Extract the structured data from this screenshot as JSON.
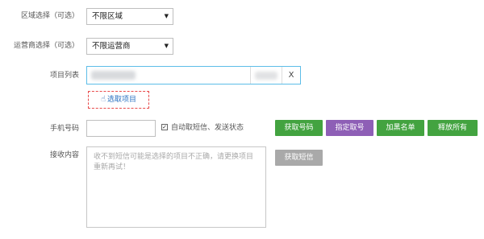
{
  "form": {
    "region": {
      "label": "区域选择（可选）",
      "value": "不限区域"
    },
    "operator": {
      "label": "运营商选择（可选）",
      "value": "不限运营商"
    },
    "project": {
      "label": "项目列表",
      "value": "",
      "clear_label": "X",
      "pick_button": "选取项目"
    },
    "phone": {
      "label": "手机号码",
      "value": "",
      "auto_checkbox_checked": true,
      "auto_label": "自动取短信、发送状态"
    },
    "buttons": {
      "get_number": "获取号码",
      "specify_number": "指定取号",
      "blacklist": "加黑名单",
      "release_all": "释放所有"
    },
    "receive": {
      "label": "接收内容",
      "placeholder": "收不到短信可能是选择的项目不正确，请更换项目重新再试！",
      "get_sms_button": "获取短信"
    }
  },
  "icons": {
    "pick": "hand-pointer-icon",
    "dropdown": "caret-down-icon",
    "check": "checkmark-icon"
  },
  "colors": {
    "green_button": "#43a340",
    "purple_button": "#8e5fb6",
    "grey_button": "#a9a9a9",
    "accent_blue": "#5dbde8",
    "dashed_red": "#e84b4b",
    "link_blue": "#2b73c2"
  }
}
